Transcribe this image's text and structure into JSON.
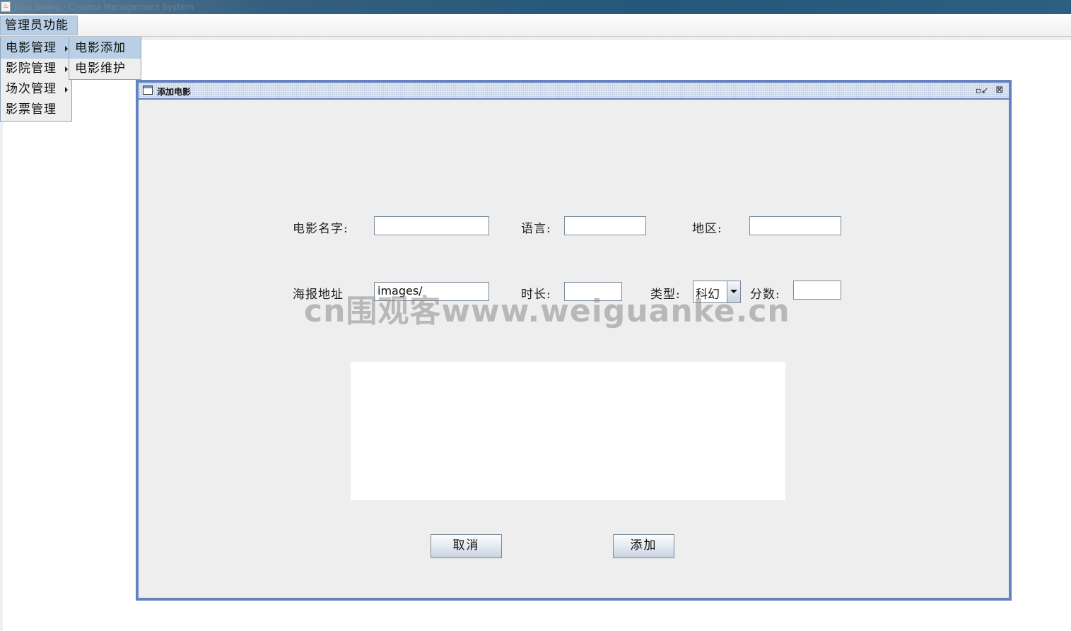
{
  "window": {
    "title": "Java Swing - Cinema Management System"
  },
  "menubar": {
    "top_menu": "管理员功能",
    "items": [
      {
        "label": "电影管理",
        "has_submenu": true,
        "selected": true
      },
      {
        "label": "影院管理",
        "has_submenu": true,
        "selected": false
      },
      {
        "label": "场次管理",
        "has_submenu": true,
        "selected": false
      },
      {
        "label": "影票管理",
        "has_submenu": false,
        "selected": false
      }
    ],
    "submenu": [
      {
        "label": "电影添加",
        "selected": true
      },
      {
        "label": "电影维护",
        "selected": false
      }
    ]
  },
  "internal_frame": {
    "title": "添加电影",
    "restore_icon": "restore-icon",
    "close_icon": "close-icon"
  },
  "form": {
    "movie_name_label": "电影名字:",
    "movie_name_value": "",
    "language_label": "语言:",
    "language_value": "",
    "region_label": "地区:",
    "region_value": "",
    "poster_label": "海报地址",
    "poster_value": "images/",
    "duration_label": "时长:",
    "duration_value": "",
    "type_label": "类型:",
    "type_value": "科幻",
    "score_label": "分数:",
    "score_value": ""
  },
  "buttons": {
    "cancel": "取消",
    "add": "添加"
  },
  "watermark": "cn围观客www.weiguanke.cn",
  "colors": {
    "menu_highlight": "#b8cfe5",
    "frame_border": "#6382bf",
    "panel_bg": "#eeeeee"
  }
}
